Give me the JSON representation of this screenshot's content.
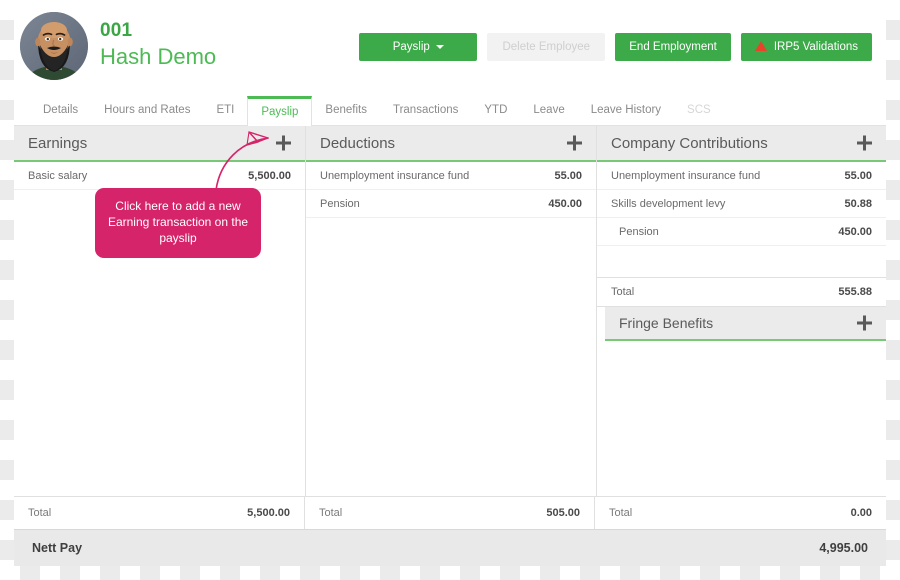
{
  "header": {
    "employee_id": "001",
    "employee_name": "Hash Demo",
    "avatar_alt": "employee-photo",
    "buttons": [
      {
        "label": "Payslip",
        "name": "payslip-dropdown-button",
        "type": "dropdown",
        "disabled": false
      },
      {
        "label": "Delete Employee",
        "name": "delete-employee-button",
        "type": "plain",
        "disabled": true
      },
      {
        "label": "End Employment",
        "name": "end-employment-button",
        "type": "plain",
        "disabled": false
      },
      {
        "label": "IRP5 Validations",
        "name": "irp5-validations-button",
        "type": "warning",
        "disabled": false
      }
    ]
  },
  "tabs": [
    {
      "label": "Details",
      "active": false,
      "disabled": false
    },
    {
      "label": "Hours and Rates",
      "active": false,
      "disabled": false
    },
    {
      "label": "ETI",
      "active": false,
      "disabled": false
    },
    {
      "label": "Payslip",
      "active": true,
      "disabled": false
    },
    {
      "label": "Benefits",
      "active": false,
      "disabled": false
    },
    {
      "label": "Transactions",
      "active": false,
      "disabled": false
    },
    {
      "label": "YTD",
      "active": false,
      "disabled": false
    },
    {
      "label": "Leave",
      "active": false,
      "disabled": false
    },
    {
      "label": "Leave History",
      "active": false,
      "disabled": false
    },
    {
      "label": "SCS",
      "active": false,
      "disabled": true
    }
  ],
  "earnings": {
    "title": "Earnings",
    "rows": [
      {
        "label": "Basic salary",
        "value": "5,500.00"
      }
    ],
    "total_label": "Total",
    "total_value": "5,500.00"
  },
  "deductions": {
    "title": "Deductions",
    "rows": [
      {
        "label": "Unemployment insurance fund",
        "value": "55.00"
      },
      {
        "label": "Pension",
        "value": "450.00"
      }
    ],
    "total_label": "Total",
    "total_value": "505.00"
  },
  "company_contributions": {
    "title": "Company Contributions",
    "rows": [
      {
        "label": "Unemployment insurance fund",
        "value": "55.00"
      },
      {
        "label": "Skills development levy",
        "value": "50.88"
      },
      {
        "label": "Pension",
        "value": "450.00"
      }
    ],
    "subtotal_label": "Total",
    "subtotal_value": "555.88"
  },
  "fringe_benefits": {
    "title": "Fringe Benefits",
    "rows": [],
    "total_label": "Total",
    "total_value": "0.00"
  },
  "nett_pay": {
    "label": "Nett Pay",
    "value": "4,995.00"
  },
  "annotation": {
    "text": "Click here to add a new Earning transaction on the payslip",
    "color": "#d6246a"
  },
  "colors": {
    "brand_green": "#3daa4a",
    "light_green": "#4cbb54",
    "section_header_bg": "#ebebeb",
    "section_underline": "#77c975",
    "annotation_pink": "#d6246a",
    "warning_red": "#e8442a",
    "nett_bg": "#e9e9e9"
  }
}
